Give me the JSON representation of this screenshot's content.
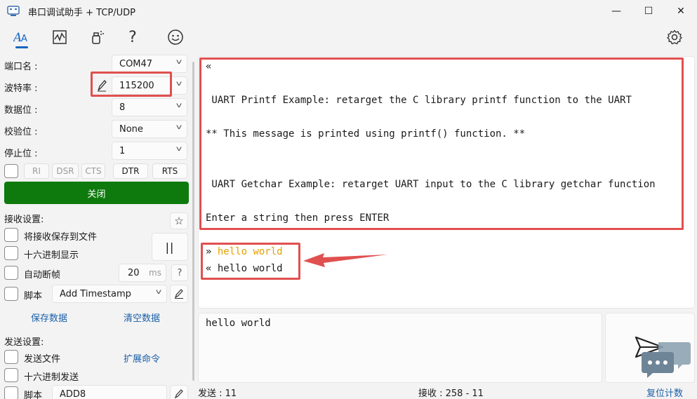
{
  "window": {
    "title": "串口调试助手 + TCP/UDP",
    "minimize": "—",
    "maximize": "☐",
    "close": "✕"
  },
  "toolbar": {
    "icons": [
      "text-format-icon",
      "chart-icon",
      "spray-icon",
      "help-icon",
      "smiley-icon",
      "settings-icon"
    ],
    "help_glyph": "?"
  },
  "serial": {
    "port_label": "端口名 :",
    "port_value": "COM47",
    "baud_label": "波特率 :",
    "baud_value": "115200",
    "databits_label": "数据位 :",
    "databits_value": "8",
    "parity_label": "校验位 :",
    "parity_value": "None",
    "stopbits_label": "停止位 :",
    "stopbits_value": "1",
    "pins": {
      "ri": "RI",
      "dsr": "DSR",
      "cts": "CTS",
      "dtr": "DTR",
      "rts": "RTS"
    },
    "close_button": "关闭"
  },
  "receive_settings": {
    "heading": "接收设置:",
    "save_to_file": "将接收保存到文件",
    "hex_display": "十六进制显示",
    "auto_frame": "自动断帧",
    "frame_ms_value": "20",
    "frame_ms_unit": "ms",
    "script_label": "脚本",
    "script_value": "Add Timestamp",
    "save_data": "保存数据",
    "clear_data": "清空数据",
    "pause_glyph": "||",
    "star_glyph": "☆",
    "help_glyph": "?"
  },
  "send_settings": {
    "heading": "发送设置:",
    "send_file": "发送文件",
    "ext_command": "扩展命令",
    "hex_send": "十六进制发送",
    "script_label": "脚本",
    "script_value": "ADD8"
  },
  "receive_log": {
    "lines": [
      "«",
      "",
      " UART Printf Example: retarget the C library printf function to the UART",
      "",
      "** This message is printed using printf() function. **",
      "",
      "",
      " UART Getchar Example: retarget UART input to the C library getchar function",
      "",
      "Enter a string then press ENTER"
    ],
    "echo_sent_prefix": "»",
    "echo_sent_text": "hello world",
    "echo_recv_prefix": "«",
    "echo_recv_text": "hello world"
  },
  "send_box": {
    "text": "hello world"
  },
  "status_bar": {
    "sent": "发送 : 11",
    "received": "接收 : 258 - 11",
    "reset": "复位计数"
  },
  "colors": {
    "accent": "#1565c0",
    "close_button_bg": "#0e7a0d",
    "highlight_red": "#e0504f",
    "sent_text": "#e6a100"
  }
}
